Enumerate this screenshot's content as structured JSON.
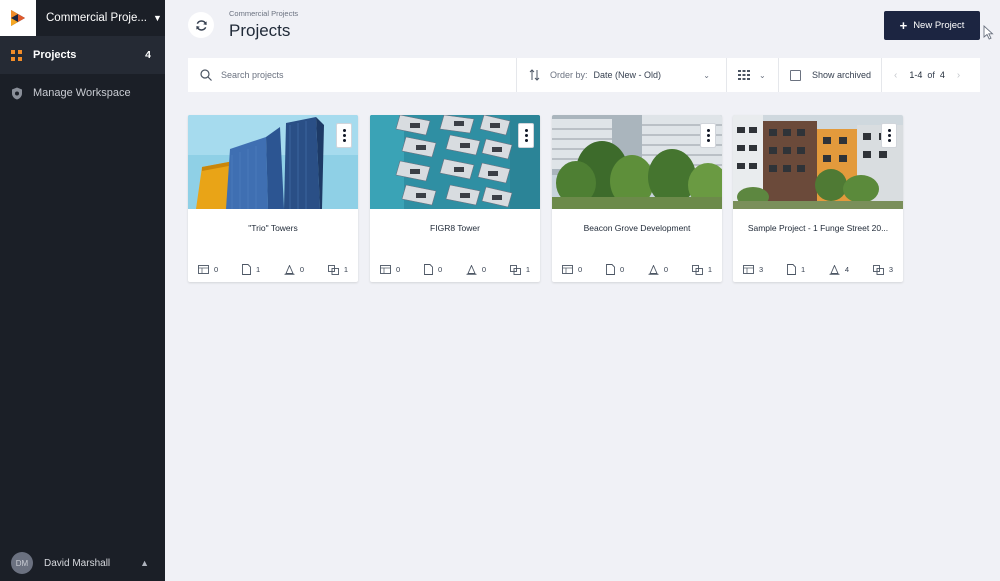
{
  "sidebar": {
    "workspace_name": "Commercial Proje...",
    "nav": [
      {
        "label": "Projects",
        "count": "4"
      },
      {
        "label": "Manage Workspace"
      }
    ],
    "user": {
      "initials": "DM",
      "name": "David Marshall"
    }
  },
  "header": {
    "breadcrumb": "Commercial Projects",
    "title": "Projects",
    "new_project_label": "New Project"
  },
  "toolbar": {
    "search_placeholder": "Search projects",
    "order_label": "Order by:",
    "order_value": "Date (New - Old)",
    "show_archived_label": "Show archived",
    "pager_range": "1-4",
    "pager_of": "of",
    "pager_total": "4"
  },
  "projects": [
    {
      "title": "\"Trio\" Towers",
      "stats": {
        "sheets": "0",
        "documents": "1",
        "models": "0",
        "issues": "1"
      }
    },
    {
      "title": "FIGR8 Tower",
      "stats": {
        "sheets": "0",
        "documents": "0",
        "models": "0",
        "issues": "1"
      }
    },
    {
      "title": "Beacon Grove Development",
      "stats": {
        "sheets": "0",
        "documents": "0",
        "models": "0",
        "issues": "1"
      }
    },
    {
      "title": "Sample Project - 1 Funge Street 20...",
      "stats": {
        "sheets": "3",
        "documents": "1",
        "models": "4",
        "issues": "3"
      }
    }
  ],
  "colors": {
    "sidebar_bg": "#1b1f27",
    "primary_button": "#1c2541",
    "page_bg": "#f0f1f6",
    "accent_orange": "#f28c28"
  }
}
